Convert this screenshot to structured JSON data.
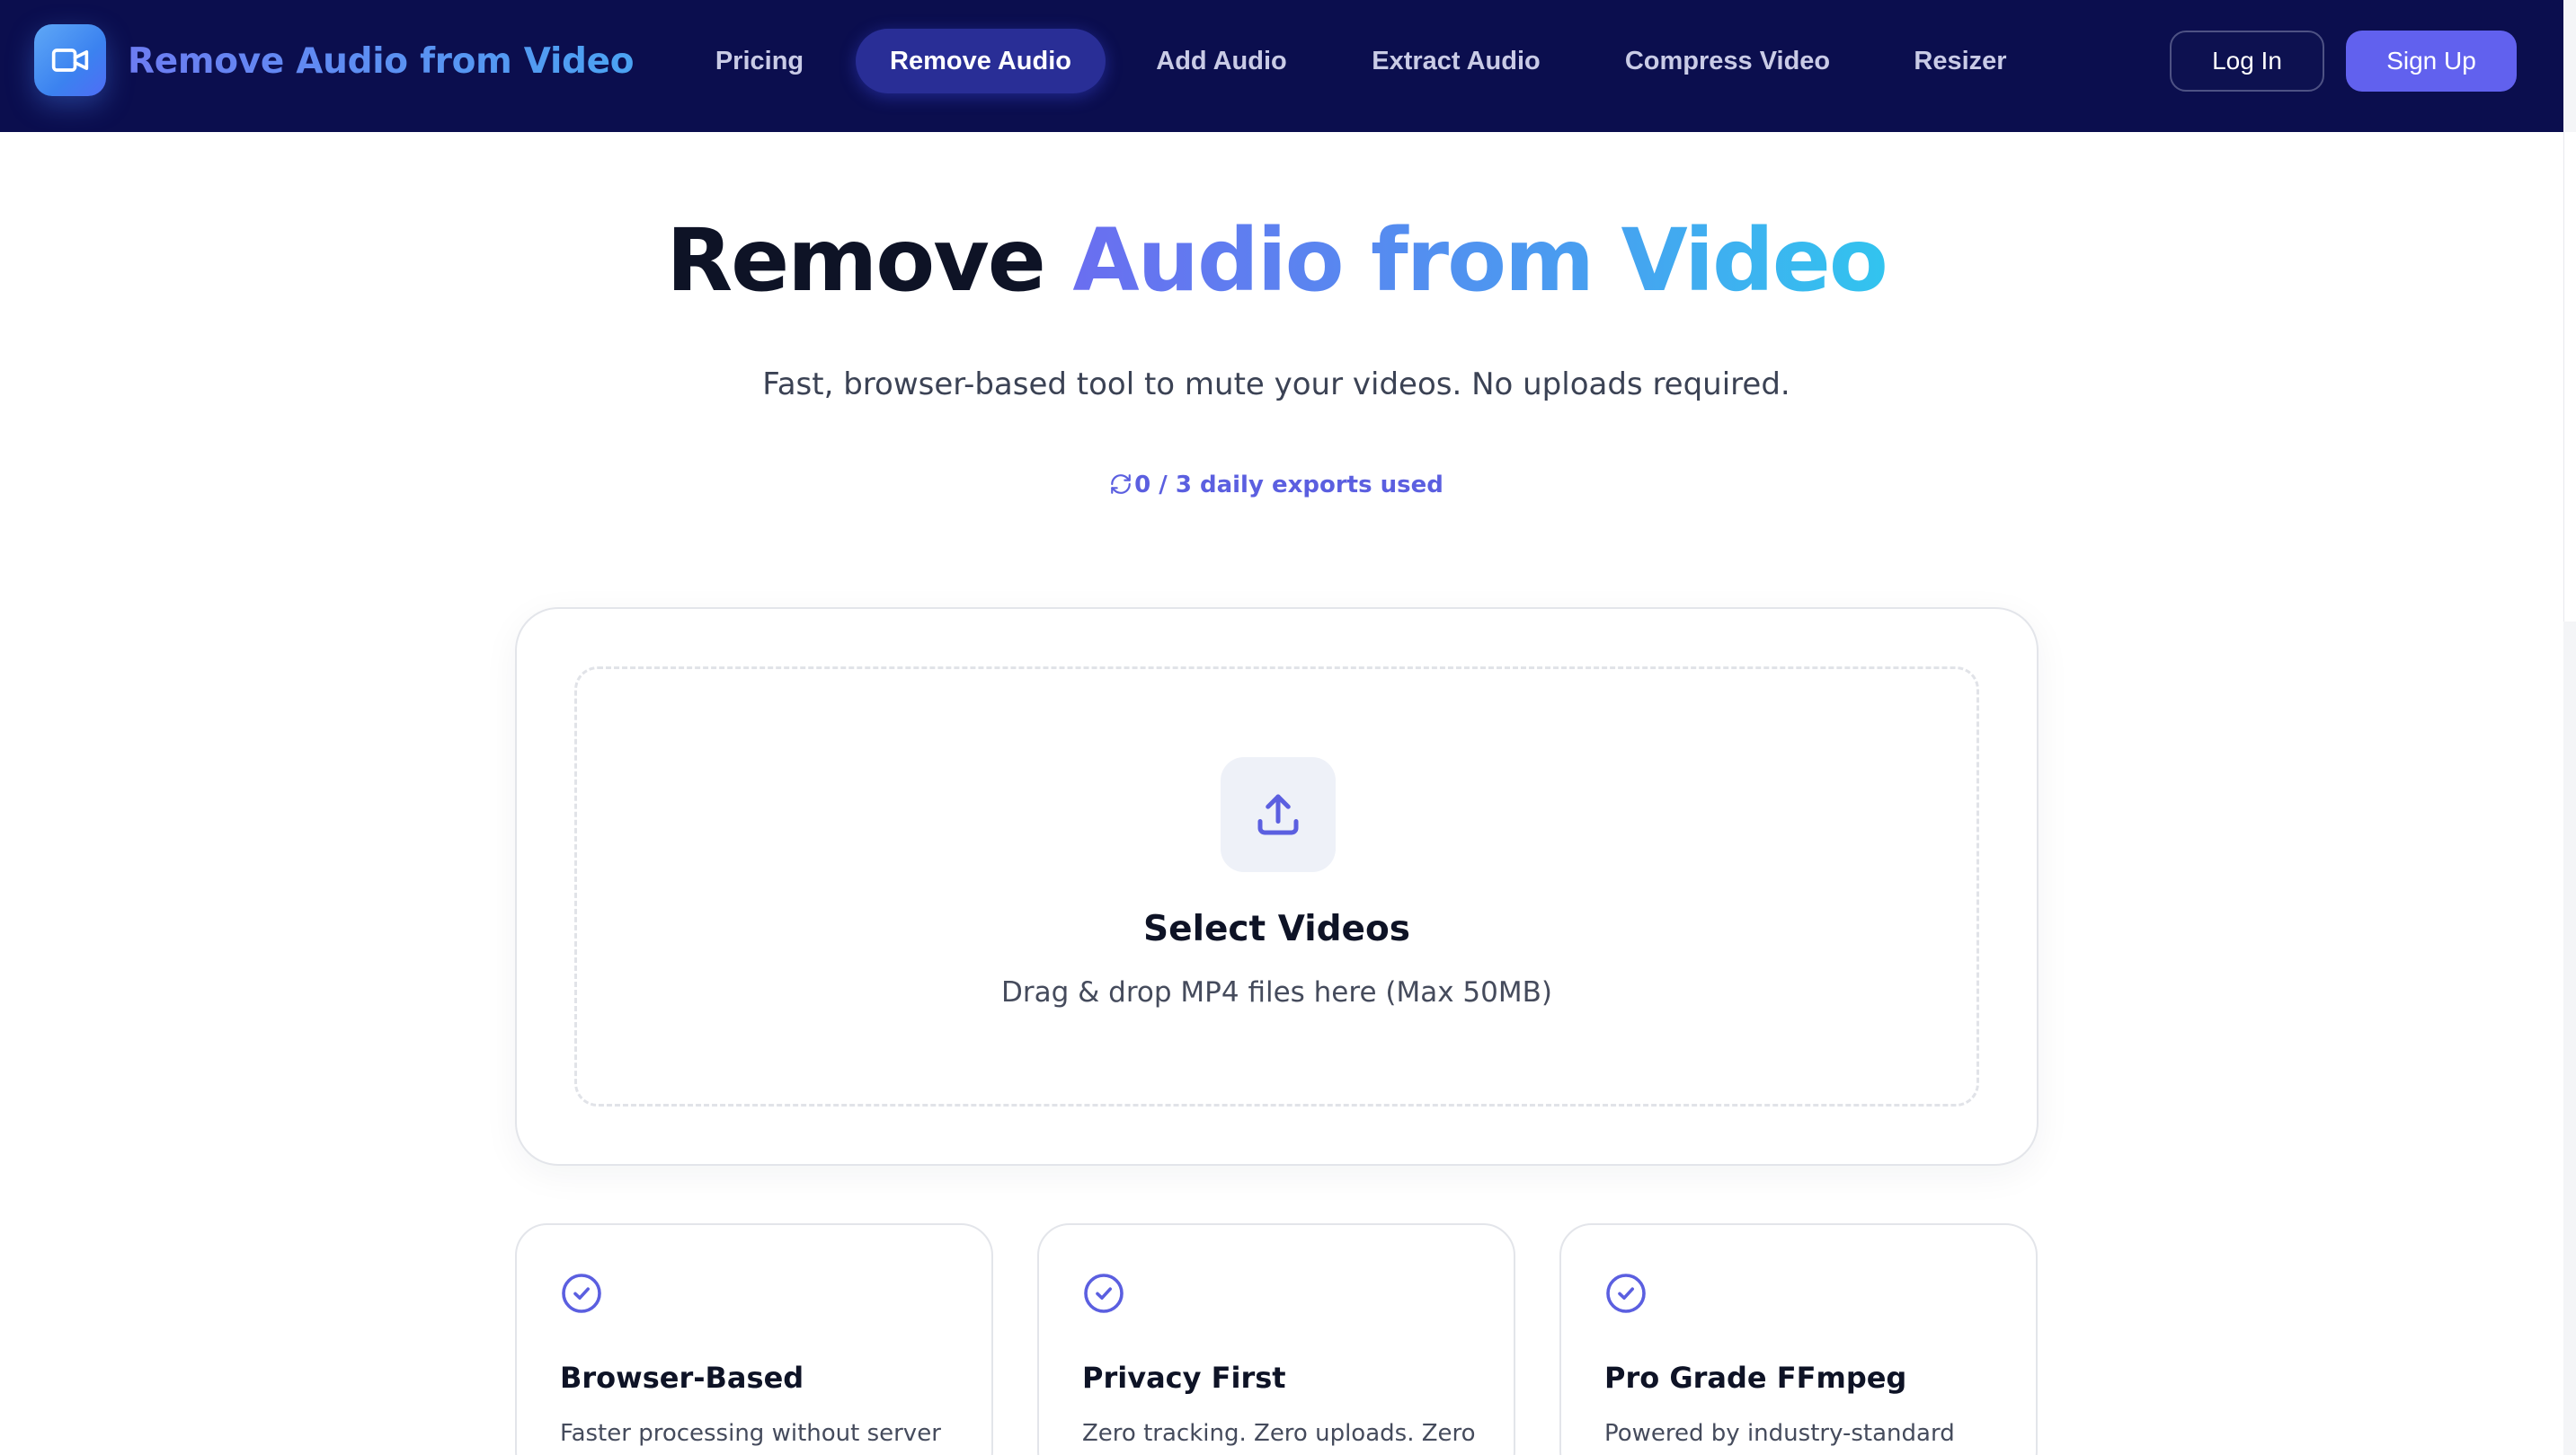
{
  "header": {
    "brand": "Remove Audio from Video",
    "logo_icon": "video-camera-icon",
    "nav": [
      {
        "label": "Pricing",
        "active": false
      },
      {
        "label": "Remove Audio",
        "active": true
      },
      {
        "label": "Add Audio",
        "active": false
      },
      {
        "label": "Extract Audio",
        "active": false
      },
      {
        "label": "Compress Video",
        "active": false
      },
      {
        "label": "Resizer",
        "active": false
      }
    ],
    "login_label": "Log In",
    "signup_label": "Sign Up"
  },
  "hero": {
    "title_dark": "Remove",
    "title_accent": "Audio from Video",
    "subtitle": "Fast, browser-based tool to mute your videos. No uploads required.",
    "quota": "0 / 3 daily exports used",
    "quota_icon": "refresh-icon"
  },
  "uploader": {
    "icon": "upload-icon",
    "title": "Select Videos",
    "subtitle": "Drag & drop MP4 files here (Max 50MB)"
  },
  "features": [
    {
      "title": "Browser-Based",
      "desc": "Faster processing without server",
      "icon": "check-circle-icon"
    },
    {
      "title": "Privacy First",
      "desc": "Zero tracking. Zero uploads. Zero",
      "icon": "check-circle-icon"
    },
    {
      "title": "Pro Grade FFmpeg",
      "desc": "Powered by industry-standard",
      "icon": "check-circle-icon"
    }
  ],
  "colors": {
    "header_bg": "#0b0e4e",
    "accent": "#6161ee",
    "nav_active_bg": "#292e96",
    "gradient_start": "#6a6ef0",
    "gradient_end": "#32c4ef"
  }
}
